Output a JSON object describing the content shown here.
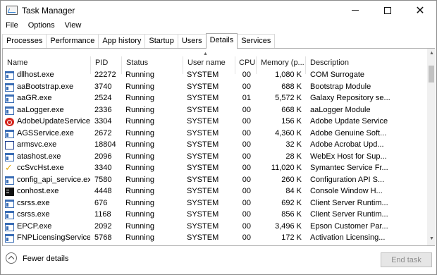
{
  "window": {
    "title": "Task Manager"
  },
  "menu": [
    "File",
    "Options",
    "View"
  ],
  "tabs": [
    "Processes",
    "Performance",
    "App history",
    "Startup",
    "Users",
    "Details",
    "Services"
  ],
  "active_tab": "Details",
  "columns": {
    "name": "Name",
    "pid": "PID",
    "status": "Status",
    "user": "User name",
    "cpu": "CPU",
    "memory": "Memory (p...",
    "description": "Description"
  },
  "rows": [
    {
      "icon": "generic-app-icon",
      "name": "dllhost.exe",
      "pid": "22272",
      "status": "Running",
      "user": "SYSTEM",
      "cpu": "00",
      "memory": "1,080 K",
      "description": "COM Surrogate"
    },
    {
      "icon": "generic-app-icon",
      "name": "aaBootstrap.exe",
      "pid": "3740",
      "status": "Running",
      "user": "SYSTEM",
      "cpu": "00",
      "memory": "688 K",
      "description": "Bootstrap Module"
    },
    {
      "icon": "generic-app-icon",
      "name": "aaGR.exe",
      "pid": "2524",
      "status": "Running",
      "user": "SYSTEM",
      "cpu": "01",
      "memory": "5,572 K",
      "description": "Galaxy Repository se..."
    },
    {
      "icon": "generic-app-icon",
      "name": "aaLogger.exe",
      "pid": "2336",
      "status": "Running",
      "user": "SYSTEM",
      "cpu": "00",
      "memory": "668 K",
      "description": "aaLogger Module"
    },
    {
      "icon": "adobe-icon",
      "name": "AdobeUpdateService...",
      "pid": "3304",
      "status": "Running",
      "user": "SYSTEM",
      "cpu": "00",
      "memory": "156 K",
      "description": "Adobe Update Service"
    },
    {
      "icon": "generic-app-icon",
      "name": "AGSService.exe",
      "pid": "2672",
      "status": "Running",
      "user": "SYSTEM",
      "cpu": "00",
      "memory": "4,360 K",
      "description": "Adobe Genuine Soft..."
    },
    {
      "icon": "armsvc-icon",
      "name": "armsvc.exe",
      "pid": "18804",
      "status": "Running",
      "user": "SYSTEM",
      "cpu": "00",
      "memory": "32 K",
      "description": "Adobe Acrobat Upd..."
    },
    {
      "icon": "generic-app-icon",
      "name": "atashost.exe",
      "pid": "2096",
      "status": "Running",
      "user": "SYSTEM",
      "cpu": "00",
      "memory": "28 K",
      "description": "WebEx Host for Sup..."
    },
    {
      "icon": "checkmark-icon",
      "name": "ccSvcHst.exe",
      "pid": "3340",
      "status": "Running",
      "user": "SYSTEM",
      "cpu": "00",
      "memory": "11,020 K",
      "description": "Symantec Service Fr..."
    },
    {
      "icon": "generic-app-icon",
      "name": "config_api_service.exe",
      "pid": "7580",
      "status": "Running",
      "user": "SYSTEM",
      "cpu": "00",
      "memory": "260 K",
      "description": "Configuration API S..."
    },
    {
      "icon": "console-icon",
      "name": "conhost.exe",
      "pid": "4448",
      "status": "Running",
      "user": "SYSTEM",
      "cpu": "00",
      "memory": "84 K",
      "description": "Console Window H..."
    },
    {
      "icon": "generic-app-icon",
      "name": "csrss.exe",
      "pid": "676",
      "status": "Running",
      "user": "SYSTEM",
      "cpu": "00",
      "memory": "692 K",
      "description": "Client Server Runtim..."
    },
    {
      "icon": "generic-app-icon",
      "name": "csrss.exe",
      "pid": "1168",
      "status": "Running",
      "user": "SYSTEM",
      "cpu": "00",
      "memory": "856 K",
      "description": "Client Server Runtim..."
    },
    {
      "icon": "generic-app-icon",
      "name": "EPCP.exe",
      "pid": "2092",
      "status": "Running",
      "user": "SYSTEM",
      "cpu": "00",
      "memory": "3,496 K",
      "description": "Epson Customer Par..."
    },
    {
      "icon": "generic-app-icon",
      "name": "FNPLicensingService...",
      "pid": "5768",
      "status": "Running",
      "user": "SYSTEM",
      "cpu": "00",
      "memory": "172 K",
      "description": "Activation Licensing..."
    }
  ],
  "footer": {
    "fewer_details": "Fewer details",
    "end_task": "End task"
  }
}
